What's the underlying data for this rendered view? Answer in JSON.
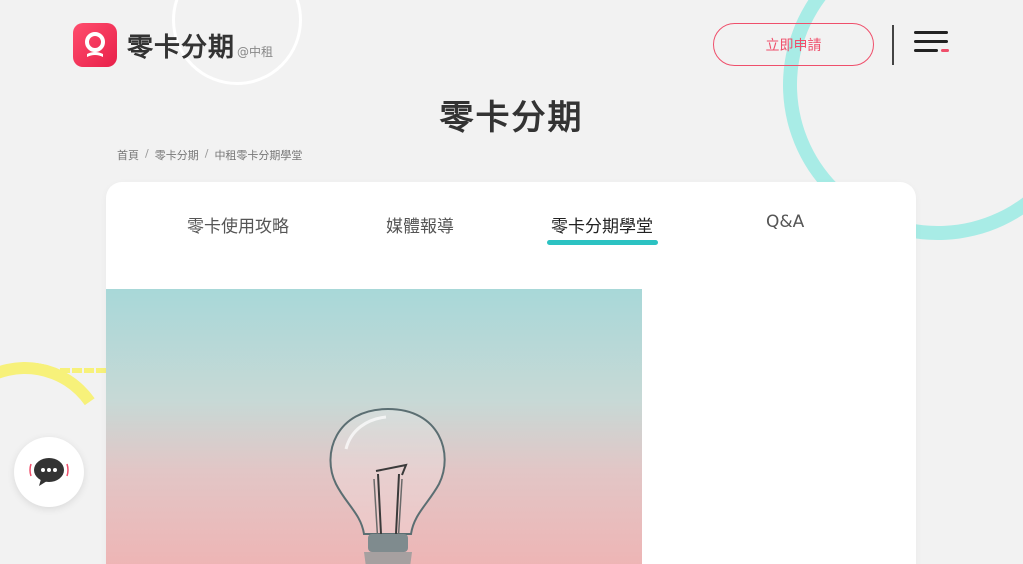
{
  "header": {
    "logo_text": "零卡分期",
    "logo_sub": "@中租",
    "apply_label": "立即申請",
    "brand_color": "#ef4f6b"
  },
  "page_title": "零卡分期",
  "breadcrumb": [
    "首頁",
    "零卡分期",
    "中租零卡分期學堂"
  ],
  "tabs": [
    {
      "label": "零卡使用攻略",
      "active": false
    },
    {
      "label": "媒體報導",
      "active": false
    },
    {
      "label": "零卡分期學堂",
      "active": true
    },
    {
      "label": "Q&A",
      "active": false
    }
  ],
  "accent_color": "#2cc2c2",
  "icons": {
    "logo": "logo-icon",
    "menu": "hamburger-menu-icon",
    "chat": "chat-bubble-icon",
    "hero": "lightbulb-image"
  }
}
